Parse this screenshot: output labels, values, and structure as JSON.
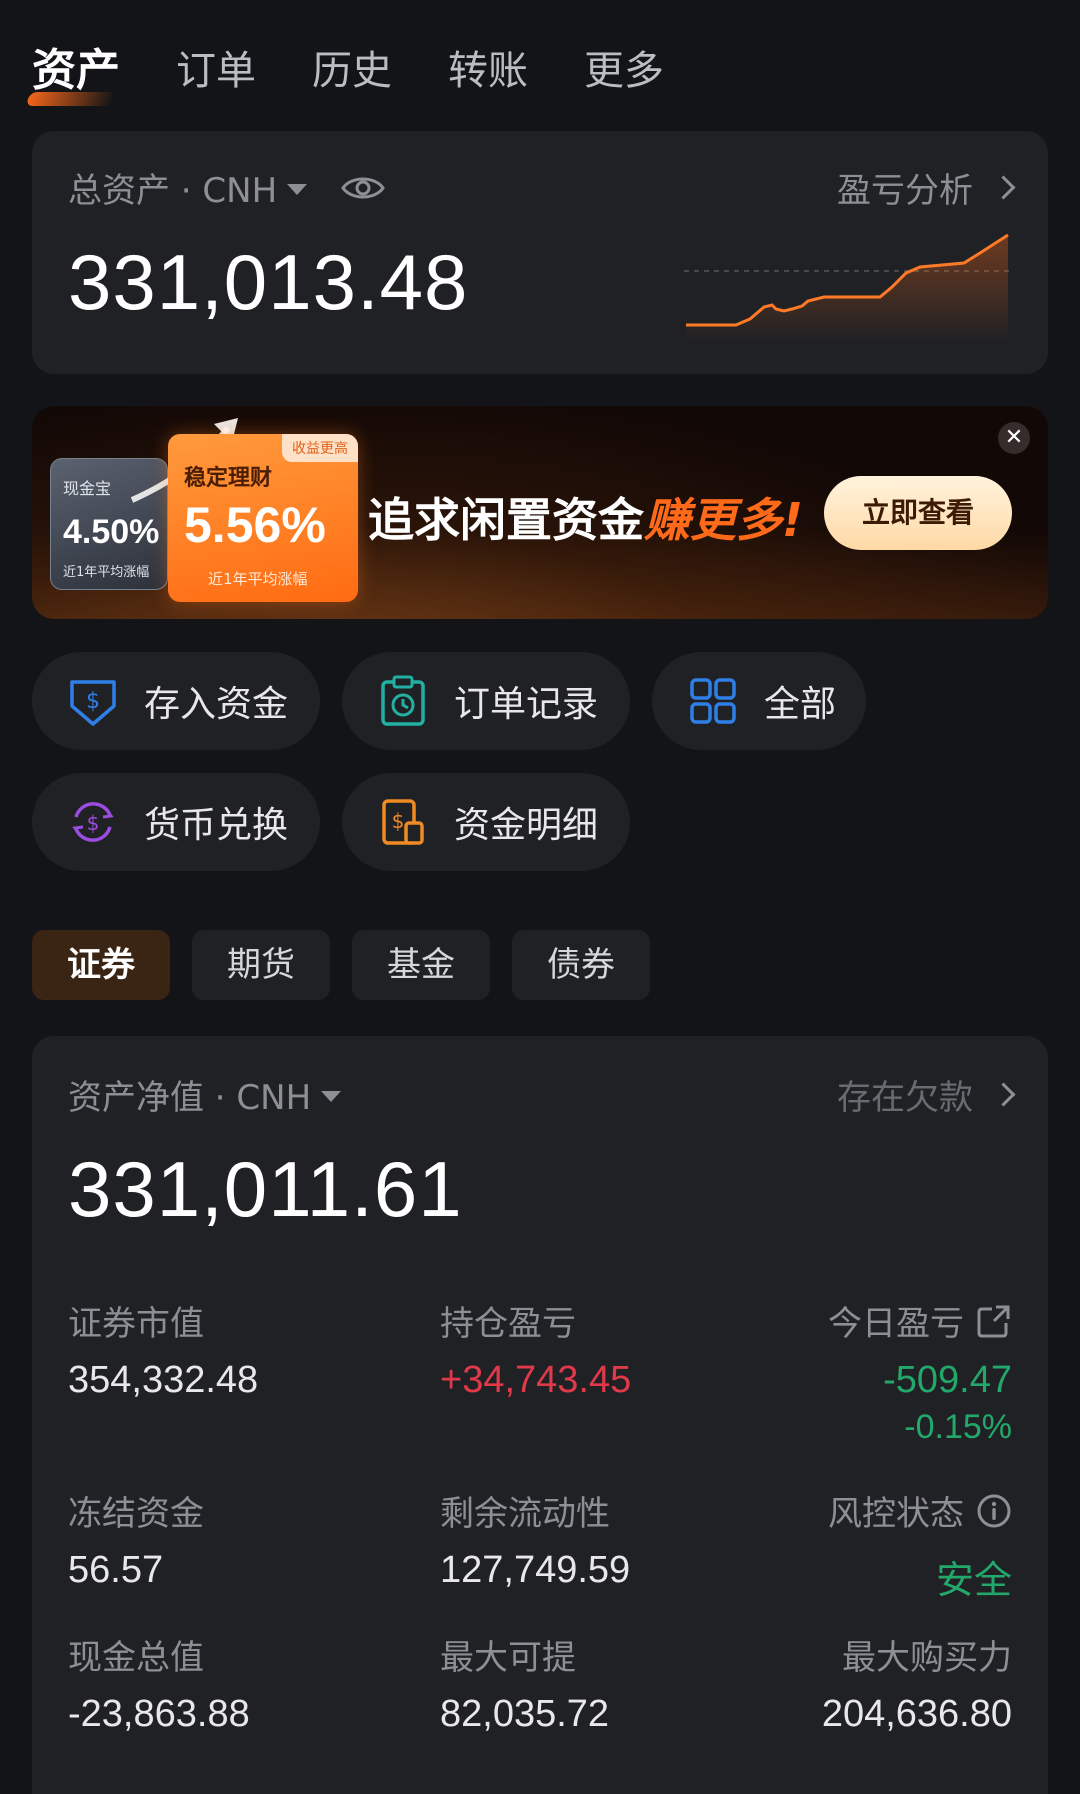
{
  "top_tabs": [
    "资产",
    "订单",
    "历史",
    "转账",
    "更多"
  ],
  "total_card": {
    "label": "总资产 · CNH",
    "value": "331,013.48",
    "pl_link": "盈亏分析"
  },
  "banner": {
    "xianjin_title": "现金宝",
    "xianjin_rate": "4.50%",
    "xianjin_sub": "近1年平均涨幅",
    "wen_tag": "收益更高",
    "wen_title": "稳定理财",
    "wen_rate": "5.56%",
    "wen_sub": "近1年平均涨幅",
    "slogan_a": "追求闲置资金",
    "slogan_b": "赚更多!",
    "cta": "立即查看",
    "close": "✕"
  },
  "shortcuts": {
    "deposit": "存入资金",
    "orders": "订单记录",
    "all": "全部",
    "fx": "货币兑换",
    "details": "资金明细"
  },
  "segments": [
    "证券",
    "期货",
    "基金",
    "债券"
  ],
  "net_card": {
    "label": "资产净值 · CNH",
    "debt_link": "存在欠款",
    "value": "331,011.61",
    "stats": {
      "market_value": {
        "k": "证券市值",
        "v": "354,332.48"
      },
      "position_pl": {
        "k": "持仓盈亏",
        "v": "+34,743.45"
      },
      "today_pl": {
        "k": "今日盈亏",
        "v": "-509.47",
        "pct": "-0.15%"
      },
      "frozen": {
        "k": "冻结资金",
        "v": "56.57"
      },
      "liquidity": {
        "k": "剩余流动性",
        "v": "127,749.59"
      },
      "risk": {
        "k": "风控状态",
        "v": "安全"
      },
      "cash": {
        "k": "现金总值",
        "v": "-23,863.88"
      },
      "max_withdraw": {
        "k": "最大可提",
        "v": "82,035.72"
      },
      "max_buy": {
        "k": "最大购买力",
        "v": "204,636.80"
      }
    }
  },
  "colors": {
    "accent": "#ff6a1a",
    "up": "#e03a4a",
    "down": "#22a86a"
  }
}
